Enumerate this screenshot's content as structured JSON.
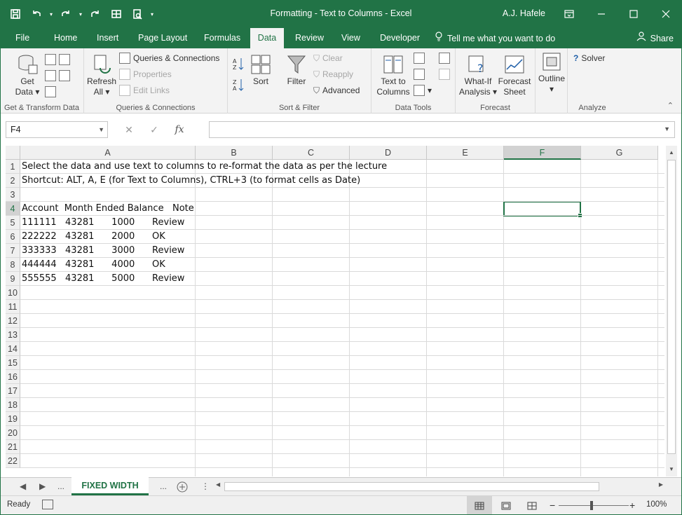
{
  "title_bar": {
    "title": "Formatting - Text to Columns  -  Excel",
    "user": "A.J. Hafele"
  },
  "tabs": [
    {
      "label": "File"
    },
    {
      "label": "Home"
    },
    {
      "label": "Insert"
    },
    {
      "label": "Page Layout"
    },
    {
      "label": "Formulas"
    },
    {
      "label": "Data"
    },
    {
      "label": "Review"
    },
    {
      "label": "View"
    },
    {
      "label": "Developer"
    }
  ],
  "tell_me": "Tell me what you want to do",
  "share": "Share",
  "ribbon": {
    "get_transform": {
      "get_data": "Get",
      "get_data2": "Data",
      "label": "Get & Transform Data"
    },
    "queries": {
      "refresh": "Refresh",
      "refresh2": "All",
      "queries_connections": "Queries & Connections",
      "properties": "Properties",
      "edit_links": "Edit Links",
      "label": "Queries & Connections"
    },
    "sort_filter": {
      "sort": "Sort",
      "filter": "Filter",
      "clear": "Clear",
      "reapply": "Reapply",
      "advanced": "Advanced",
      "label": "Sort & Filter"
    },
    "data_tools": {
      "text_to_columns": "Text to",
      "text_to_columns2": "Columns",
      "label": "Data Tools"
    },
    "forecast": {
      "what_if": "What-If",
      "what_if2": "Analysis",
      "forecast_sheet": "Forecast",
      "forecast_sheet2": "Sheet",
      "label": "Forecast"
    },
    "outline": {
      "outline": "Outline"
    },
    "analyze": {
      "solver": "Solver",
      "label": "Analyze"
    }
  },
  "formula_bar": {
    "name_box": "F4",
    "fx": "fx",
    "formula": ""
  },
  "grid": {
    "columns": [
      "A",
      "B",
      "C",
      "D",
      "E",
      "F",
      "G"
    ],
    "selected_column": "F",
    "selected_row": "4",
    "rows": [
      "1",
      "2",
      "3",
      "4",
      "5",
      "6",
      "7",
      "8",
      "9",
      "10",
      "11",
      "12",
      "13",
      "14",
      "15",
      "16",
      "17",
      "18",
      "19",
      "20",
      "21",
      "22"
    ],
    "cells": {
      "r1": "Select the data and use text to columns to re-format the data as per the lecture",
      "r2": "Shortcut: ALT, A, E (for Text to Columns), CTRL+3 (to format cells as Date)",
      "r4": "Account  Month Ended Balance   Note",
      "r5": "111111   43281      1000      Review",
      "r6": "222222   43281      2000      OK",
      "r7": "333333   43281      3000      Review",
      "r8": "444444   43281      4000      OK",
      "r9": "555555   43281      5000      Review"
    }
  },
  "sheet_tabs": {
    "ellipsis_left": "...",
    "active": "FIXED WIDTH",
    "ellipsis_right": "..."
  },
  "status": {
    "ready": "Ready",
    "zoom": "100%"
  },
  "colors": {
    "accent": "#217346"
  }
}
